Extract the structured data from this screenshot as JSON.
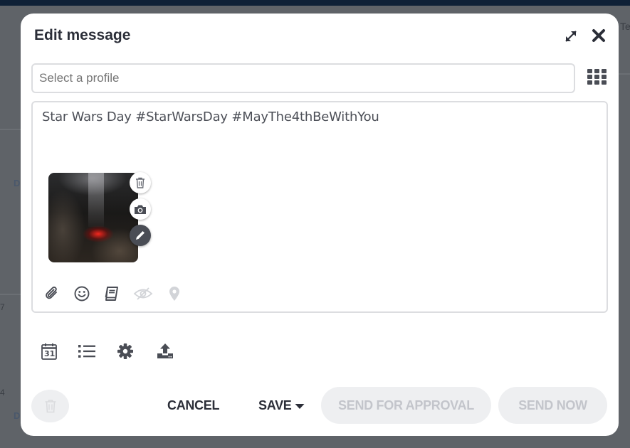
{
  "background": {
    "fragments": [
      "Te",
      "D",
      "D",
      "7",
      "4"
    ]
  },
  "modal": {
    "title": "Edit message",
    "icons": {
      "expand": "expand-icon",
      "close": "close-icon"
    }
  },
  "profile_select": {
    "placeholder": "Select a profile",
    "value": "",
    "grid_icon": "grid-icon"
  },
  "composer": {
    "text": "Star Wars Day #StarWarsDay #MayThe4thBeWithYou",
    "media": {
      "buttons": [
        "trash-icon",
        "camera-icon",
        "pencil-icon"
      ]
    },
    "toolbar": [
      "paperclip-icon",
      "smiley-icon",
      "book-icon",
      "eye-off-icon",
      "map-pin-icon"
    ]
  },
  "actions": {
    "icons": [
      "calendar-icon",
      "list-icon",
      "gear-icon",
      "upload-icon"
    ],
    "calendar_day": "31"
  },
  "footer": {
    "cancel_label": "CANCEL",
    "save_label": "SAVE",
    "send_for_approval_label": "SEND FOR APPROVAL",
    "send_now_label": "SEND NOW"
  },
  "colors": {
    "text_dark": "#2b2e38",
    "icon_gray": "#4a4d55",
    "icon_disabled": "#c8cacf",
    "disabled_button_bg": "#eeeff1",
    "disabled_button_text": "#c3c5cb",
    "border": "#dcdde0"
  }
}
